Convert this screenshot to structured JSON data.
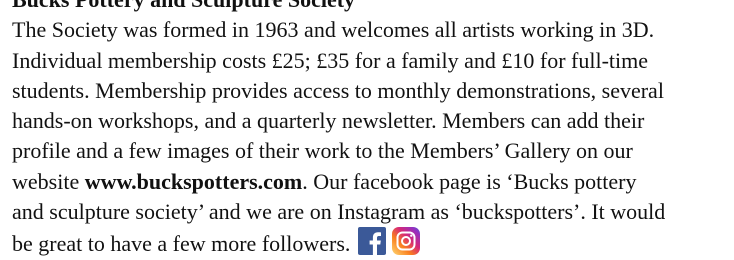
{
  "document": {
    "heading_partial": "Bucks Pottery and Sculpture Society",
    "lines": [
      "The Society was formed in 1963 and welcomes all artists working in 3D.",
      "Individual membership costs £25; £35 for a family and £10 for full-time",
      "students. Membership provides access to monthly demonstrations, several",
      "hands-on workshops, and a quarterly newsletter. Members can add their",
      "profile and a few images of their work to the Members’ Gallery on our"
    ],
    "line6_prefix": "website ",
    "website": "www.buckspotters.com",
    "line6_suffix": ". Our facebook page is ‘Bucks pottery",
    "line7": "and sculpture society’ and we are on Instagram as ‘buckspotters’. It would",
    "line8": "be great to have a few more followers."
  },
  "icons": {
    "facebook": "facebook-icon",
    "instagram": "instagram-icon"
  },
  "colors": {
    "text": "#111111",
    "facebook_blue": "#3b5998",
    "instagram_pink": "#e1306c"
  }
}
